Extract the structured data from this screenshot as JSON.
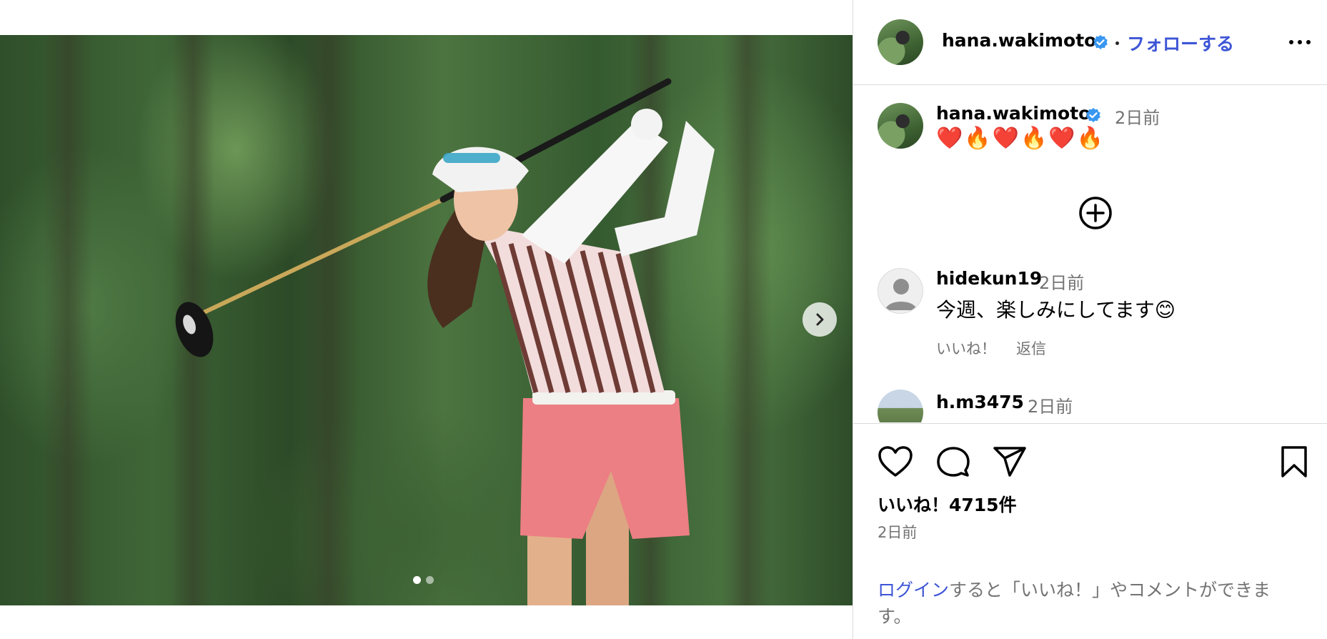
{
  "post": {
    "username": "hana.wakimoto",
    "follow_label": "フォローする",
    "caption_time": "2日前",
    "caption_text": "❤️🔥❤️🔥❤️🔥"
  },
  "media": {
    "slide_count": 2,
    "active_slide": 1,
    "next_icon": "chevron-right-icon"
  },
  "comments": [
    {
      "username": "hidekun19",
      "time": "2日前",
      "text": "今週、楽しみにしてます😊",
      "like_label": "いいね！",
      "reply_label": "返信"
    },
    {
      "username": "h.m3475",
      "time": "2日前"
    }
  ],
  "actions": {
    "icons": [
      "heart-icon",
      "comment-icon",
      "share-icon",
      "bookmark-icon"
    ],
    "likes_text": "いいね！4715件",
    "post_time": "2日前"
  },
  "login": {
    "link_text": "ログイン",
    "rest_text": "すると「いいね！」やコメントができます。"
  },
  "colors": {
    "link": "#3d55d6",
    "verified": "#3897f0",
    "muted": "#737373"
  }
}
